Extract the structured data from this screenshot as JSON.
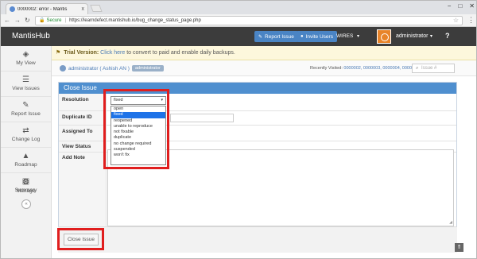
{
  "browser": {
    "tab_title": "0000002: error - Mantis",
    "tab_close": "x",
    "secure_label": "Secure",
    "url": "https://learndefect.mantishub.io/bug_change_status_page.php",
    "window_controls": [
      "−",
      "□",
      "✕"
    ]
  },
  "header": {
    "brand": "MantisHub",
    "report_issue": "Report Issue",
    "invite_users": "Invite Users",
    "project": "WIRES",
    "username": "administrator",
    "help": "?"
  },
  "sidebar": {
    "items": [
      {
        "label": "My View",
        "icon": "dashboard-icon",
        "glyph": "◈"
      },
      {
        "label": "View Issues",
        "icon": "list-icon",
        "glyph": "☰"
      },
      {
        "label": "Report Issue",
        "icon": "edit-icon",
        "glyph": "✎"
      },
      {
        "label": "Change Log",
        "icon": "retweet-icon",
        "glyph": "⇄"
      },
      {
        "label": "Roadmap",
        "icon": "road-icon",
        "glyph": "▲"
      },
      {
        "label": "Summary",
        "icon": "bar-chart-icon",
        "glyph": "▥"
      },
      {
        "label": "Manage",
        "icon": "gears-icon",
        "glyph": "⚙"
      }
    ],
    "collapse_glyph": "«"
  },
  "trial": {
    "title": "Trial Version:",
    "link": "Click here",
    "rest": " to convert to paid and enable daily backups."
  },
  "crumbs": {
    "user": "administrator ( Ashish AN )",
    "role": "administrator",
    "recent_label": "Recently Visited:",
    "recent_issues": "0000002, 0000003, 0000004, 0000001",
    "search_placeholder": "Issue #"
  },
  "form": {
    "title": "Close Issue",
    "labels": {
      "resolution": "Resolution",
      "duplicate": "Duplicate ID",
      "assigned": "Assigned To",
      "view_status": "View Status",
      "add_note": "Add Note"
    },
    "resolution_selected": "fixed",
    "resolution_options": [
      "open",
      "fixed",
      "reopened",
      "unable to reproduce",
      "not fixable",
      "duplicate",
      "no change required",
      "suspended",
      "won't fix"
    ],
    "close_button": "Close Issue"
  },
  "colors": {
    "nav_bg": "#3c3c3c",
    "accent_blue": "#4f8fcf",
    "highlight_red": "#e01e1e",
    "selected_option": "#1e73e8"
  }
}
